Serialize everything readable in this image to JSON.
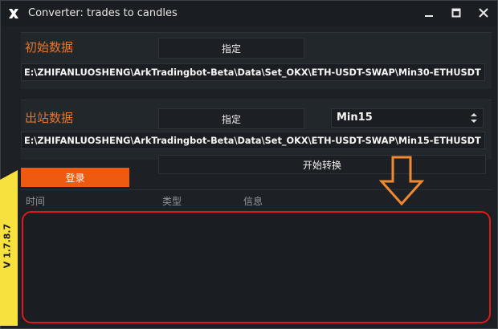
{
  "window": {
    "title": "Converter: trades to candles"
  },
  "colors": {
    "accent": "#ef5a11",
    "label": "#e5772a",
    "version_tab": "#f7e13f",
    "annotation": "#e0191a",
    "arrow": "#f08a32"
  },
  "input_section": {
    "label": "初始数据",
    "assign_button": "指定",
    "path": "E:\\ZHIFANLUOSHENG\\ArkTradingbot-Beta\\Data\\Set_OKX\\ETH-USDT-SWAP\\Min30-ETHUSDT"
  },
  "output_section": {
    "label": "出站数据",
    "assign_button": "指定",
    "timeframe": "Min15",
    "path": "E:\\ZHIFANLUOSHENG\\ArkTradingbot-Beta\\Data\\Set_OKX\\ETH-USDT-SWAP\\Min15-ETHUSDT"
  },
  "actions": {
    "login": "登录",
    "start": "开始转换"
  },
  "log": {
    "columns": [
      "时间",
      "类型",
      "信息"
    ]
  },
  "version": "V 1.7.8.7",
  "icons": {
    "app": "app-logo-icon",
    "minimize": "minimize-icon",
    "maximize": "maximize-icon",
    "close": "close-icon",
    "spinner": "up-down-spinner-icon",
    "arrow": "down-arrow-annotation-icon"
  }
}
